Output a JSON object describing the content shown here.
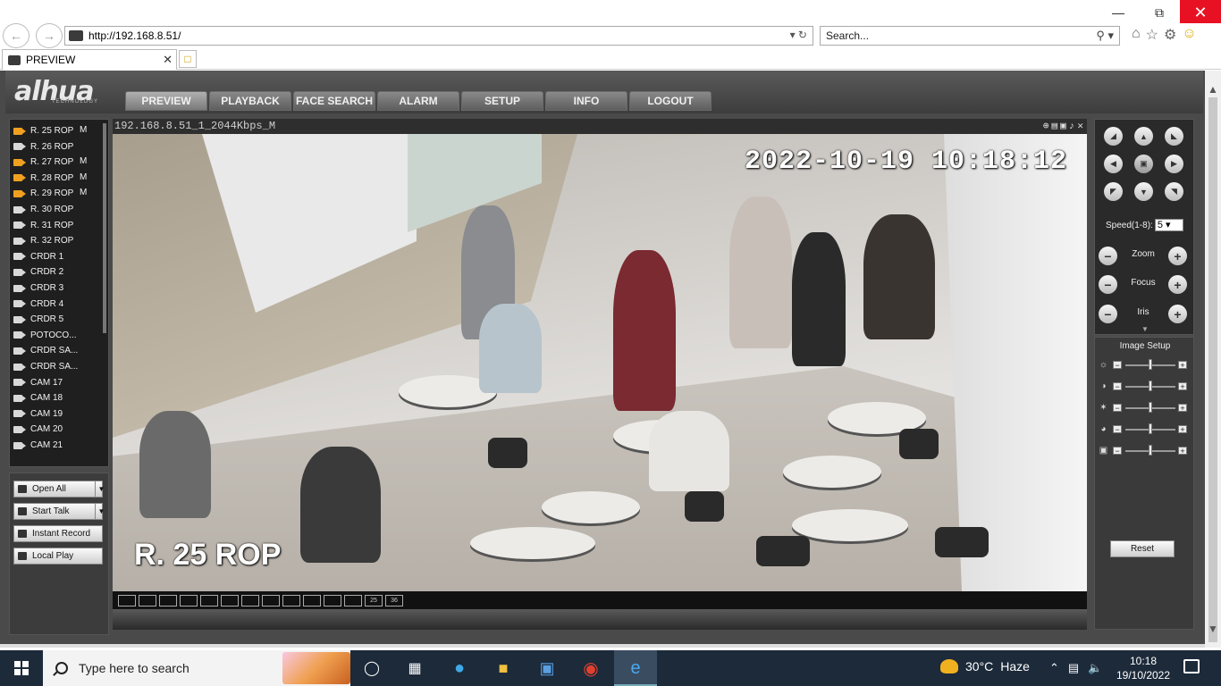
{
  "browser": {
    "url": "http://192.168.8.51/",
    "search_placeholder": "Search...",
    "tab_title": "PREVIEW"
  },
  "header": {
    "logo": "alhua",
    "logo_sub": "TECHNOLOGY",
    "menu": [
      {
        "label": "PREVIEW",
        "active": true
      },
      {
        "label": "PLAYBACK"
      },
      {
        "label": "FACE SEARCH"
      },
      {
        "label": "ALARM"
      },
      {
        "label": "SETUP"
      },
      {
        "label": "INFO"
      },
      {
        "label": "LOGOUT"
      }
    ]
  },
  "channels": [
    {
      "name": "R. 25 ROP",
      "flag": "M",
      "active": true
    },
    {
      "name": "R. 26 ROP",
      "flag": "",
      "active": false
    },
    {
      "name": "R. 27 ROP",
      "flag": "M",
      "active": true
    },
    {
      "name": "R. 28 ROP",
      "flag": "M",
      "active": true
    },
    {
      "name": "R. 29 ROP",
      "flag": "M",
      "active": true
    },
    {
      "name": "R. 30 ROP",
      "flag": "",
      "active": false
    },
    {
      "name": "R. 31 ROP",
      "flag": "",
      "active": false
    },
    {
      "name": "R. 32 ROP",
      "flag": "",
      "active": false
    },
    {
      "name": "CRDR 1",
      "flag": "",
      "active": false
    },
    {
      "name": "CRDR 2",
      "flag": "",
      "active": false
    },
    {
      "name": "CRDR 3",
      "flag": "",
      "active": false
    },
    {
      "name": "CRDR 4",
      "flag": "",
      "active": false
    },
    {
      "name": "CRDR 5",
      "flag": "",
      "active": false
    },
    {
      "name": "POTOCO...",
      "flag": "",
      "active": false
    },
    {
      "name": "CRDR SA...",
      "flag": "",
      "active": false
    },
    {
      "name": "CRDR SA...",
      "flag": "",
      "active": false
    },
    {
      "name": "CAM 17",
      "flag": "",
      "active": false
    },
    {
      "name": "CAM 18",
      "flag": "",
      "active": false
    },
    {
      "name": "CAM 19",
      "flag": "",
      "active": false
    },
    {
      "name": "CAM 20",
      "flag": "",
      "active": false
    },
    {
      "name": "CAM 21",
      "flag": "",
      "active": false
    }
  ],
  "actions": {
    "open_all": "Open All",
    "start_talk": "Start Talk",
    "instant_record": "Instant Record",
    "local_play": "Local Play"
  },
  "video": {
    "stream_label": "192.168.8.51_1_2044Kbps_M",
    "osd_datetime": "2022-10-19 10:18:12",
    "osd_channel": "R. 25 ROP"
  },
  "layout_buttons": [
    "",
    "",
    "",
    "",
    "",
    "",
    "",
    "",
    "",
    "",
    "",
    "",
    "25",
    "36"
  ],
  "ptz": {
    "speed_label": "Speed(1-8):",
    "speed_value": "5",
    "zoom": "Zoom",
    "focus": "Focus",
    "iris": "Iris"
  },
  "image_setup": {
    "title": "Image Setup",
    "reset": "Reset",
    "sliders": [
      {
        "icon": "brightness-icon",
        "level": 0.5
      },
      {
        "icon": "contrast-icon",
        "level": 0.5
      },
      {
        "icon": "saturation-icon",
        "level": 0.5
      },
      {
        "icon": "hue-icon",
        "level": 0.5
      },
      {
        "icon": "sharpness-icon",
        "level": 0.5
      }
    ]
  },
  "taskbar": {
    "search_text": "Type here to search",
    "temperature": "30°C",
    "weather": "Haze",
    "time": "10:18",
    "date": "19/10/2022"
  }
}
